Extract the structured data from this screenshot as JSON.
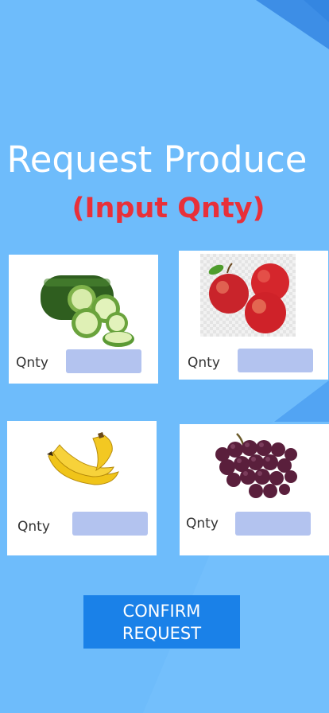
{
  "header": {
    "title": "Request Produce",
    "subtitle": "(Input Qnty)"
  },
  "produce": [
    {
      "name": "cucumber",
      "qty_label": "Qnty",
      "qty_value": ""
    },
    {
      "name": "apples",
      "qty_label": "Qnty",
      "qty_value": ""
    },
    {
      "name": "bananas",
      "qty_label": "Qnty",
      "qty_value": ""
    },
    {
      "name": "grapes",
      "qty_label": "Qnty",
      "qty_value": ""
    }
  ],
  "actions": {
    "confirm_label": "CONFIRM\nREQUEST"
  },
  "colors": {
    "background": "#6ebcfb",
    "title": "#ffffff",
    "subtitle": "#e8303a",
    "input_fill": "#b3c3ef",
    "button": "#1a81e8"
  }
}
